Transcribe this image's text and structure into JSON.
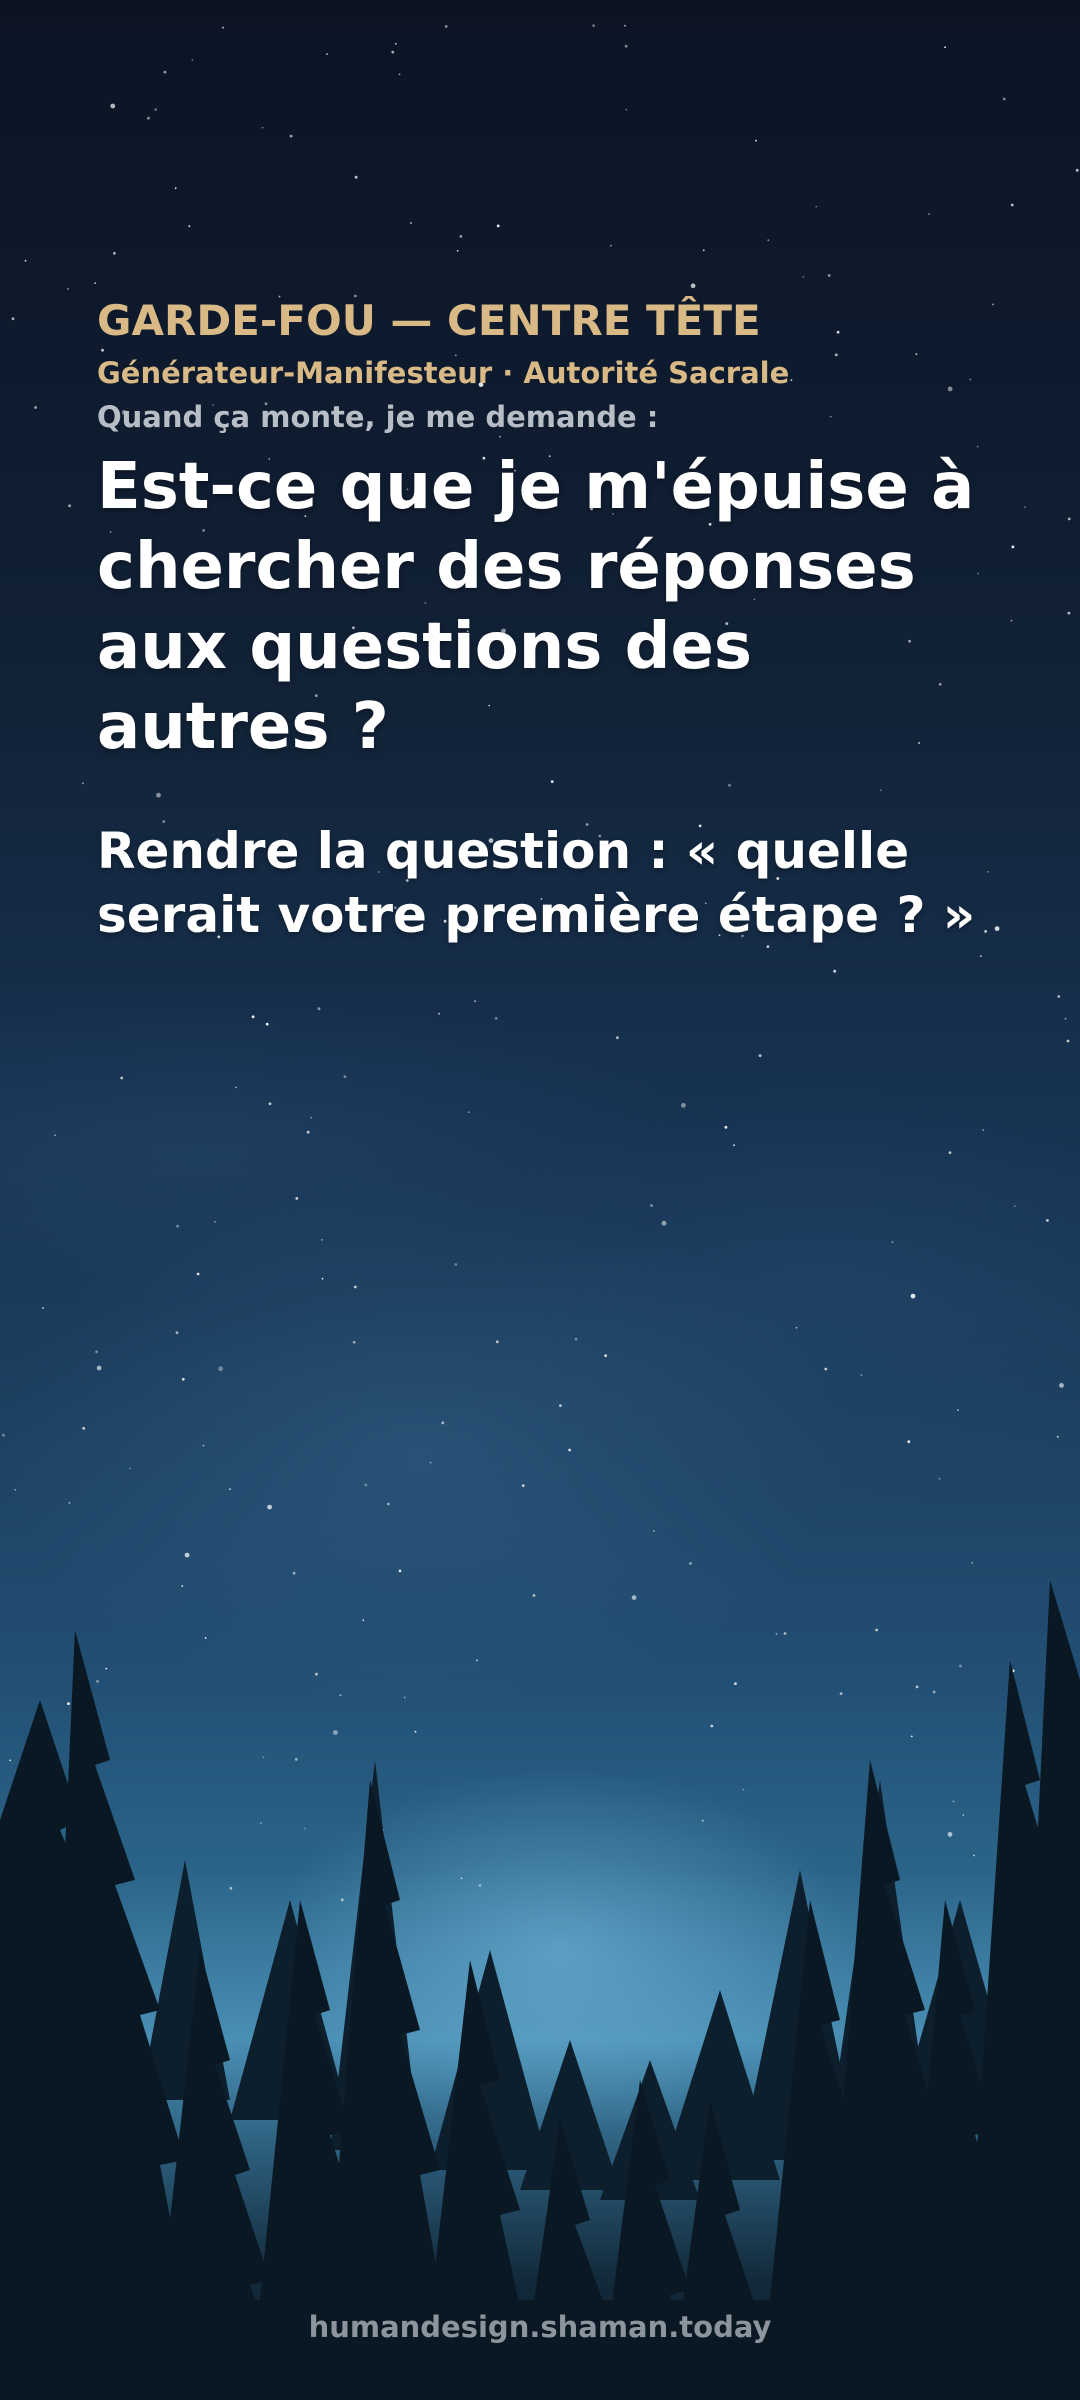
{
  "header": {
    "kicker": "GARDE-FOU — CENTRE TÊTE",
    "subtitle": "Générateur-Manifesteur · Autorité Sacrale",
    "prompt": "Quand ça monte, je me demande :"
  },
  "main": {
    "question": "Est-ce que je m'épuise à chercher des réponses aux questions des autres ?",
    "answer": "Rendre la question : « quelle serait votre première étape ? »"
  },
  "footer": {
    "site": "humandesign.shaman.today"
  },
  "background": {
    "description_icon": "night-sky-forest-icon",
    "colors": {
      "sky_top": "#0c1424",
      "sky_glow": "#4a8fb4",
      "accent_gold": "#d9b985",
      "muted_gray": "#b8bec6"
    }
  }
}
